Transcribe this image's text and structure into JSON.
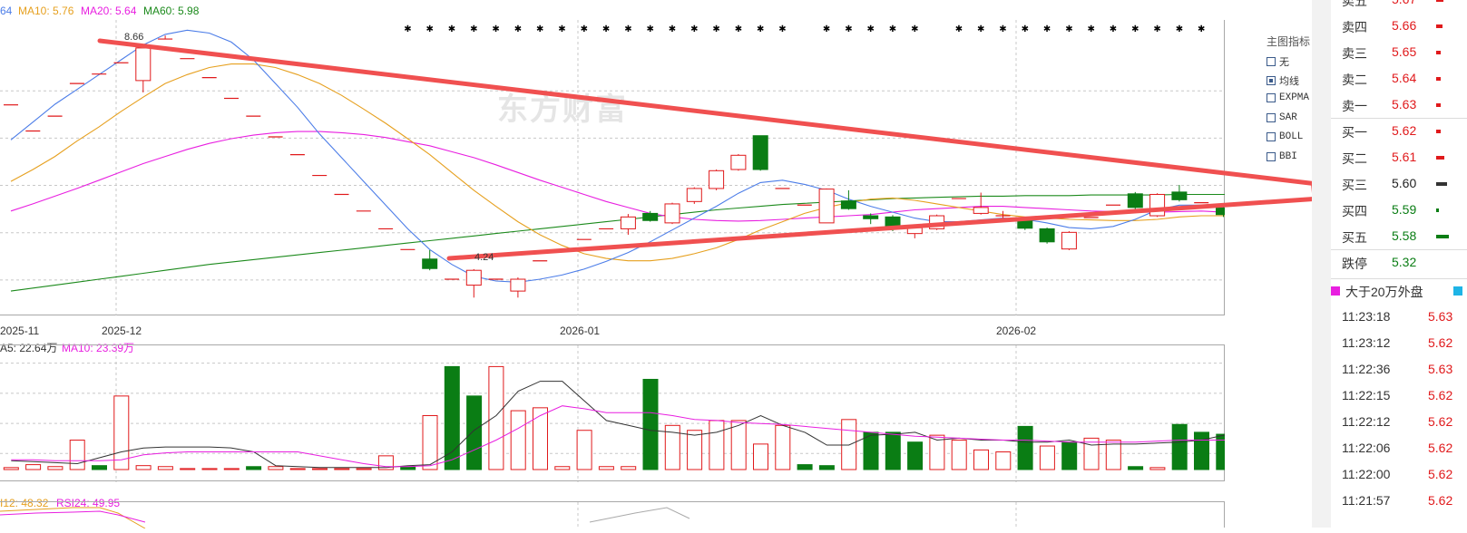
{
  "ma_legend": {
    "ma5_partial": "64",
    "ma10": "MA10: 5.76",
    "ma20": "MA20: 5.64",
    "ma60": "MA60: 5.98"
  },
  "colors": {
    "up": "#e0191b",
    "down": "#0a7d14",
    "ma5": "#4c7de8",
    "ma10": "#e6a01f",
    "ma20": "#e81fe0",
    "ma60": "#1c8a1c",
    "grid": "#c8c8c8",
    "trend_arrow": "#f05050"
  },
  "annotations": {
    "high": "8.66",
    "low": "4.24"
  },
  "dates": [
    "2025-11",
    "2025-12",
    "2026-01",
    "2026-02"
  ],
  "watermark": "东方财富",
  "indicator_panel": {
    "title": "主图指标",
    "items": [
      {
        "label": "无",
        "checked": false
      },
      {
        "label": "均线",
        "checked": true
      },
      {
        "label": "EXPMA",
        "checked": false
      },
      {
        "label": "SAR",
        "checked": false
      },
      {
        "label": "BOLL",
        "checked": false
      },
      {
        "label": "BBI",
        "checked": false
      }
    ]
  },
  "volume_legend": {
    "ma5": "A5: 22.64万",
    "ma10": "MA10: 23.39万"
  },
  "rsi_legend": {
    "rsi12": "I12: 48.32",
    "rsi24": "RSI24: 49.95"
  },
  "order_book": [
    {
      "label": "卖五",
      "price": "5.67",
      "side": "ask",
      "bar": 8
    },
    {
      "label": "卖四",
      "price": "5.66",
      "side": "ask",
      "bar": 7
    },
    {
      "label": "卖三",
      "price": "5.65",
      "side": "ask",
      "bar": 5
    },
    {
      "label": "卖二",
      "price": "5.64",
      "side": "ask",
      "bar": 5
    },
    {
      "label": "卖一",
      "price": "5.63",
      "side": "ask",
      "bar": 5
    },
    {
      "label": "买一",
      "price": "5.62",
      "side": "bid",
      "bar": 5
    },
    {
      "label": "买二",
      "price": "5.61",
      "side": "bid",
      "bar": 9
    },
    {
      "label": "买三",
      "price": "5.60",
      "side": "bid",
      "bar": 12
    },
    {
      "label": "买四",
      "price": "5.59",
      "side": "bid",
      "bar": 3
    },
    {
      "label": "买五",
      "price": "5.58",
      "side": "bid",
      "bar": 14
    },
    {
      "label": "跌停",
      "price": "5.32",
      "side": "limit",
      "bar": 0
    }
  ],
  "trades_header": "大于20万外盘",
  "trades": [
    {
      "time": "11:23:18",
      "price": "5.63"
    },
    {
      "time": "11:23:12",
      "price": "5.62"
    },
    {
      "time": "11:22:36",
      "price": "5.63"
    },
    {
      "time": "11:22:15",
      "price": "5.62"
    },
    {
      "time": "11:22:12",
      "price": "5.62"
    },
    {
      "time": "11:22:06",
      "price": "5.62"
    },
    {
      "time": "11:22:00",
      "price": "5.62"
    },
    {
      "time": "11:21:57",
      "price": "5.62"
    }
  ],
  "chart_data": {
    "type": "candlestick",
    "price_range": [
      4.0,
      8.8
    ],
    "candles": [
      {
        "o": 7.49,
        "c": 7.49,
        "h": 7.49,
        "l": 7.49
      },
      {
        "o": 7.05,
        "c": 7.05,
        "h": 7.05,
        "l": 7.05
      },
      {
        "o": 7.3,
        "c": 7.3,
        "h": 7.3,
        "l": 7.3
      },
      {
        "o": 7.85,
        "c": 7.85,
        "h": 7.85,
        "l": 7.85
      },
      {
        "o": 8.01,
        "c": 8.01,
        "h": 8.01,
        "l": 8.01
      },
      {
        "o": 8.2,
        "c": 8.2,
        "h": 8.2,
        "l": 8.2
      },
      {
        "o": 7.9,
        "c": 8.45,
        "h": 8.5,
        "l": 7.7
      },
      {
        "o": 8.6,
        "c": 8.6,
        "h": 8.66,
        "l": 8.6
      },
      {
        "o": 8.27,
        "c": 8.27,
        "h": 8.27,
        "l": 8.27
      },
      {
        "o": 7.95,
        "c": 7.95,
        "h": 7.95,
        "l": 7.95
      },
      {
        "o": 7.6,
        "c": 7.6,
        "h": 7.6,
        "l": 7.6
      },
      {
        "o": 7.3,
        "c": 7.3,
        "h": 7.3,
        "l": 7.3
      },
      {
        "o": 6.95,
        "c": 6.95,
        "h": 6.95,
        "l": 6.95
      },
      {
        "o": 6.65,
        "c": 6.65,
        "h": 6.65,
        "l": 6.65
      },
      {
        "o": 6.3,
        "c": 6.3,
        "h": 6.3,
        "l": 6.3
      },
      {
        "o": 5.98,
        "c": 5.98,
        "h": 5.98,
        "l": 5.98
      },
      {
        "o": 5.7,
        "c": 5.7,
        "h": 5.7,
        "l": 5.7
      },
      {
        "o": 5.4,
        "c": 5.4,
        "h": 5.4,
        "l": 5.4
      },
      {
        "o": 5.05,
        "c": 5.05,
        "h": 5.05,
        "l": 5.05
      },
      {
        "o": 4.89,
        "c": 4.73,
        "h": 5.04,
        "l": 4.7
      },
      {
        "o": 4.55,
        "c": 4.55,
        "h": 4.55,
        "l": 4.55
      },
      {
        "o": 4.45,
        "c": 4.7,
        "h": 4.72,
        "l": 4.24
      },
      {
        "o": 4.55,
        "c": 4.55,
        "h": 4.55,
        "l": 4.55
      },
      {
        "o": 4.35,
        "c": 4.55,
        "h": 4.58,
        "l": 4.24
      },
      {
        "o": 4.86,
        "c": 4.86,
        "h": 4.86,
        "l": 4.86
      },
      {
        "o": 5.04,
        "c": 5.04,
        "h": 5.04,
        "l": 5.04
      },
      {
        "o": 5.22,
        "c": 5.22,
        "h": 5.22,
        "l": 5.22
      },
      {
        "o": 5.4,
        "c": 5.4,
        "h": 5.4,
        "l": 5.4
      },
      {
        "o": 5.4,
        "c": 5.6,
        "h": 5.65,
        "l": 5.3
      },
      {
        "o": 5.66,
        "c": 5.54,
        "h": 5.7,
        "l": 5.52
      },
      {
        "o": 5.5,
        "c": 5.82,
        "h": 5.84,
        "l": 5.48
      },
      {
        "o": 5.86,
        "c": 6.08,
        "h": 6.1,
        "l": 5.82
      },
      {
        "o": 6.08,
        "c": 6.38,
        "h": 6.4,
        "l": 6.05
      },
      {
        "o": 6.4,
        "c": 6.64,
        "h": 6.66,
        "l": 6.38
      },
      {
        "o": 6.97,
        "c": 6.4,
        "h": 6.97,
        "l": 6.38
      },
      {
        "o": 6.08,
        "c": 6.08,
        "h": 6.08,
        "l": 6.08
      },
      {
        "o": 5.8,
        "c": 5.8,
        "h": 5.8,
        "l": 5.8
      },
      {
        "o": 5.5,
        "c": 6.07,
        "h": 6.08,
        "l": 5.5
      },
      {
        "o": 5.87,
        "c": 5.74,
        "h": 6.05,
        "l": 5.72
      },
      {
        "o": 5.62,
        "c": 5.57,
        "h": 5.66,
        "l": 5.48
      },
      {
        "o": 5.6,
        "c": 5.4,
        "h": 5.63,
        "l": 5.36
      },
      {
        "o": 5.32,
        "c": 5.42,
        "h": 5.44,
        "l": 5.24
      },
      {
        "o": 5.4,
        "c": 5.62,
        "h": 5.64,
        "l": 5.38
      },
      {
        "o": 5.91,
        "c": 5.91,
        "h": 5.91,
        "l": 5.91
      },
      {
        "o": 5.66,
        "c": 5.76,
        "h": 6.01,
        "l": 5.64
      },
      {
        "o": 5.62,
        "c": 5.62,
        "h": 5.7,
        "l": 5.52
      },
      {
        "o": 5.55,
        "c": 5.41,
        "h": 5.58,
        "l": 5.38
      },
      {
        "o": 5.4,
        "c": 5.18,
        "h": 5.42,
        "l": 5.15
      },
      {
        "o": 5.06,
        "c": 5.34,
        "h": 5.36,
        "l": 5.04
      },
      {
        "o": 5.59,
        "c": 5.59,
        "h": 5.59,
        "l": 5.59
      },
      {
        "o": 5.8,
        "c": 5.8,
        "h": 5.8,
        "l": 5.8
      },
      {
        "o": 5.99,
        "c": 5.76,
        "h": 6.02,
        "l": 5.72
      },
      {
        "o": 5.62,
        "c": 5.98,
        "h": 6.0,
        "l": 5.6
      },
      {
        "o": 6.02,
        "c": 5.89,
        "h": 6.14,
        "l": 5.86
      },
      {
        "o": 5.84,
        "c": 5.84,
        "h": 5.84,
        "l": 5.84
      },
      {
        "o": 5.75,
        "c": 5.64,
        "h": 5.78,
        "l": 5.6
      },
      {
        "o": 5.62,
        "c": 5.74,
        "h": 5.76,
        "l": 5.6
      },
      {
        "o": 5.68,
        "c": 5.68,
        "h": 5.68,
        "l": 5.68
      },
      {
        "o": 5.64,
        "c": 5.66,
        "h": 5.72,
        "l": 5.6
      }
    ],
    "ma5": [
      6.9,
      7.2,
      7.5,
      7.75,
      8.0,
      8.25,
      8.5,
      8.68,
      8.75,
      8.7,
      8.55,
      8.25,
      7.85,
      7.45,
      7.0,
      6.6,
      6.2,
      5.8,
      5.4,
      5.05,
      4.8,
      4.6,
      4.52,
      4.5,
      4.55,
      4.62,
      4.72,
      4.85,
      5.0,
      5.18,
      5.38,
      5.58,
      5.78,
      6.0,
      6.18,
      6.22,
      6.15,
      6.05,
      5.9,
      5.78,
      5.68,
      5.58,
      5.52,
      5.52,
      5.55,
      5.58,
      5.56,
      5.5,
      5.42,
      5.4,
      5.44,
      5.56,
      5.72,
      5.8,
      5.8,
      5.76,
      5.72,
      5.7,
      5.68
    ],
    "ma10": [
      6.2,
      6.4,
      6.62,
      6.88,
      7.12,
      7.38,
      7.62,
      7.85,
      8.0,
      8.12,
      8.18,
      8.18,
      8.12,
      8.0,
      7.85,
      7.65,
      7.42,
      7.18,
      6.92,
      6.65,
      6.35,
      6.05,
      5.78,
      5.52,
      5.3,
      5.12,
      4.98,
      4.9,
      4.86,
      4.86,
      4.9,
      4.98,
      5.08,
      5.22,
      5.38,
      5.52,
      5.66,
      5.76,
      5.84,
      5.9,
      5.92,
      5.88,
      5.82,
      5.76,
      5.7,
      5.64,
      5.6,
      5.58,
      5.56,
      5.55,
      5.54,
      5.54,
      5.56,
      5.6,
      5.62,
      5.62,
      5.62,
      5.62,
      5.6
    ],
    "ma20": [
      5.7,
      5.82,
      5.95,
      6.08,
      6.22,
      6.36,
      6.5,
      6.62,
      6.74,
      6.84,
      6.92,
      6.98,
      7.02,
      7.04,
      7.04,
      7.02,
      6.99,
      6.94,
      6.87,
      6.8,
      6.7,
      6.6,
      6.48,
      6.35,
      6.22,
      6.1,
      5.98,
      5.86,
      5.76,
      5.66,
      5.6,
      5.56,
      5.54,
      5.53,
      5.54,
      5.56,
      5.58,
      5.6,
      5.62,
      5.64,
      5.68,
      5.72,
      5.74,
      5.76,
      5.78,
      5.78,
      5.76,
      5.74,
      5.72,
      5.7,
      5.69,
      5.68,
      5.68,
      5.69,
      5.7,
      5.68,
      5.66,
      5.65,
      5.64
    ],
    "ma60": [
      4.35,
      4.4,
      4.45,
      4.5,
      4.55,
      4.6,
      4.65,
      4.7,
      4.75,
      4.8,
      4.84,
      4.88,
      4.92,
      4.96,
      5.0,
      5.04,
      5.08,
      5.12,
      5.16,
      5.2,
      5.24,
      5.28,
      5.32,
      5.36,
      5.4,
      5.44,
      5.48,
      5.52,
      5.56,
      5.6,
      5.64,
      5.68,
      5.72,
      5.75,
      5.78,
      5.81,
      5.83,
      5.85,
      5.87,
      5.89,
      5.91,
      5.92,
      5.93,
      5.94,
      5.95,
      5.95,
      5.96,
      5.96,
      5.96,
      5.97,
      5.97,
      5.97,
      5.97,
      5.98,
      5.98,
      5.98,
      5.98,
      5.98,
      5.98
    ],
    "volume": [
      0.3,
      0.2,
      0.5,
      0.3,
      3.0,
      0.4,
      7.5,
      0.4,
      0.3,
      0.1,
      0.1,
      0.1,
      0.3,
      0.3,
      0.1,
      0.1,
      0.1,
      0.1,
      1.4,
      0.3,
      5.5,
      10.5,
      7.5,
      10.5,
      6.0,
      6.3,
      0.3,
      4.0,
      0.3,
      0.3,
      9.2,
      4.5,
      4.0,
      5.0,
      5.0,
      2.6,
      4.5,
      0.5,
      0.4,
      5.1,
      3.8,
      3.8,
      2.8,
      3.5,
      3.0,
      2.0,
      1.8,
      4.4,
      2.4,
      2.8,
      3.2,
      3.0,
      0.3,
      0.2,
      4.6,
      3.8,
      3.6,
      3.2,
      3.2,
      2.6,
      2.0,
      1.0
    ],
    "vol_ma5": [
      0.9,
      0.8,
      0.7,
      0.6,
      1.2,
      1.8,
      2.2,
      2.3,
      2.3,
      2.3,
      2.2,
      1.8,
      0.4,
      0.3,
      0.2,
      0.2,
      0.2,
      0.2,
      0.4,
      0.5,
      1.8,
      4.0,
      5.5,
      8.0,
      9.0,
      9.0,
      7.0,
      5.0,
      4.5,
      4.0,
      3.8,
      3.5,
      3.8,
      4.5,
      5.5,
      4.5,
      3.8,
      2.5,
      2.5,
      3.5,
      3.6,
      3.8,
      3.0,
      3.2,
      3.0,
      3.0,
      2.8,
      2.8,
      3.0,
      2.5,
      2.6,
      2.6,
      2.7,
      2.8,
      3.0,
      3.5,
      3.2,
      3.0,
      2.6
    ],
    "vol_ma10": [
      1.0,
      1.0,
      0.9,
      0.9,
      0.9,
      1.0,
      1.5,
      1.7,
      1.8,
      1.8,
      1.8,
      1.8,
      1.8,
      1.8,
      1.4,
      1.0,
      0.6,
      0.3,
      0.3,
      0.4,
      1.0,
      2.0,
      3.0,
      4.2,
      5.5,
      6.5,
      6.2,
      5.8,
      5.8,
      5.8,
      5.5,
      5.1,
      5.0,
      4.8,
      4.7,
      4.6,
      4.4,
      4.2,
      4.0,
      3.8,
      3.6,
      3.4,
      3.3,
      3.2,
      3.1,
      3.0,
      3.0,
      2.9,
      2.8,
      2.8,
      2.8,
      2.8,
      2.9,
      3.0,
      3.0,
      3.0,
      2.9,
      2.8,
      2.7
    ],
    "vol_unit": "万"
  }
}
